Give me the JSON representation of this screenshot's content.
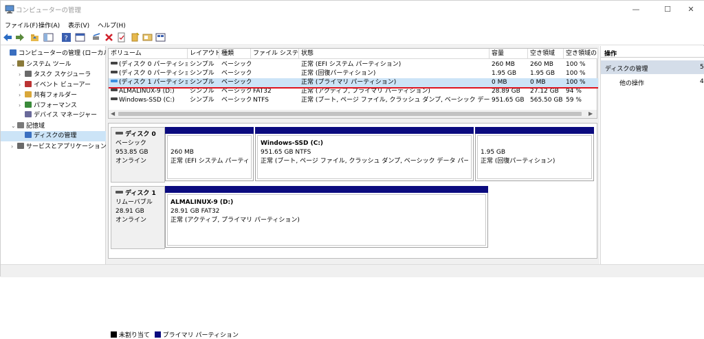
{
  "window": {
    "title": "コンピューターの管理"
  },
  "menu": [
    "ファイル(F)",
    "操作(A)",
    "表示(V)",
    "ヘルプ(H)"
  ],
  "tree": [
    {
      "label": "コンピューターの管理 (ローカル)",
      "indent": 0
    },
    {
      "label": "システム ツール",
      "indent": 1
    },
    {
      "label": "タスク スケジューラ",
      "indent": 2
    },
    {
      "label": "イベント ビューアー",
      "indent": 2
    },
    {
      "label": "共有フォルダー",
      "indent": 2
    },
    {
      "label": "パフォーマンス",
      "indent": 2
    },
    {
      "label": "デバイス マネージャー",
      "indent": 2
    },
    {
      "label": "記憶域",
      "indent": 1
    },
    {
      "label": "ディスクの管理",
      "indent": 2
    },
    {
      "label": "サービスとアプリケーション",
      "indent": 1
    }
  ],
  "volume_list": {
    "headers": [
      "ボリューム",
      "レイアウト",
      "種類",
      "ファイル システム",
      "状態",
      "容量",
      "空き領域",
      "空き領域の"
    ],
    "rows": [
      [
        "(ディスク 0 パーティション 1)",
        "シンプル",
        "ベーシック",
        "",
        "正常 (EFI システム パーティション)",
        "260 MB",
        "260 MB",
        "100 %"
      ],
      [
        "(ディスク 0 パーティション 4)",
        "シンプル",
        "ベーシック",
        "",
        "正常 (回復パーティション)",
        "1.95 GB",
        "1.95 GB",
        "100 %"
      ],
      [
        "(ディスク 1 パーティション 2)",
        "シンプル",
        "ベーシック",
        "",
        "正常 (プライマリ パーティション)",
        "0 MB",
        "0 MB",
        "100 %"
      ],
      [
        "ALMALINUX-9 (D:)",
        "シンプル",
        "ベーシック",
        "FAT32",
        "正常 (アクティブ, プライマリ パーティション)",
        "28.89 GB",
        "27.12 GB",
        "94 %"
      ],
      [
        "Windows-SSD (C:)",
        "シンプル",
        "ベーシック",
        "NTFS",
        "正常 (ブート, ページ ファイル, クラッシュ ダンプ, ベーシック データ パーティション)",
        "951.65 GB",
        "565.50 GB",
        "59 %"
      ]
    ]
  },
  "disks": [
    {
      "name": "ディスク 0",
      "type": "ベーシック",
      "size": "953.85 GB",
      "status": "オンライン",
      "partitions": [
        {
          "title": "",
          "size": "260 MB",
          "status": "正常 (EFI システム パーティション)"
        },
        {
          "title": "Windows-SSD (C:)",
          "size": "951.65 GB NTFS",
          "status": "正常 (ブート, ページ ファイル, クラッシュ ダンプ, ベーシック データ パーティション)"
        },
        {
          "title": "",
          "size": "1.95 GB",
          "status": "正常 (回復パーティション)"
        }
      ]
    },
    {
      "name": "ディスク 1",
      "type": "リムーバブル",
      "size": "28.91 GB",
      "status": "オンライン",
      "partitions": [
        {
          "title": "ALMALINUX-9 (D:)",
          "size": "28.91 GB FAT32",
          "status": "正常 (アクティブ, プライマリ パーティション)"
        }
      ]
    }
  ],
  "legend": [
    "未割り当て",
    "プライマリ パーティション"
  ],
  "actions": {
    "header": "操作",
    "section": "ディスクの管理",
    "section_badge": "5",
    "item": "他の操作",
    "item_badge": "4"
  },
  "colors": {
    "partition_bar": "#0b0b7f",
    "selection": "#cce4f7",
    "underline": "#e0141e"
  }
}
